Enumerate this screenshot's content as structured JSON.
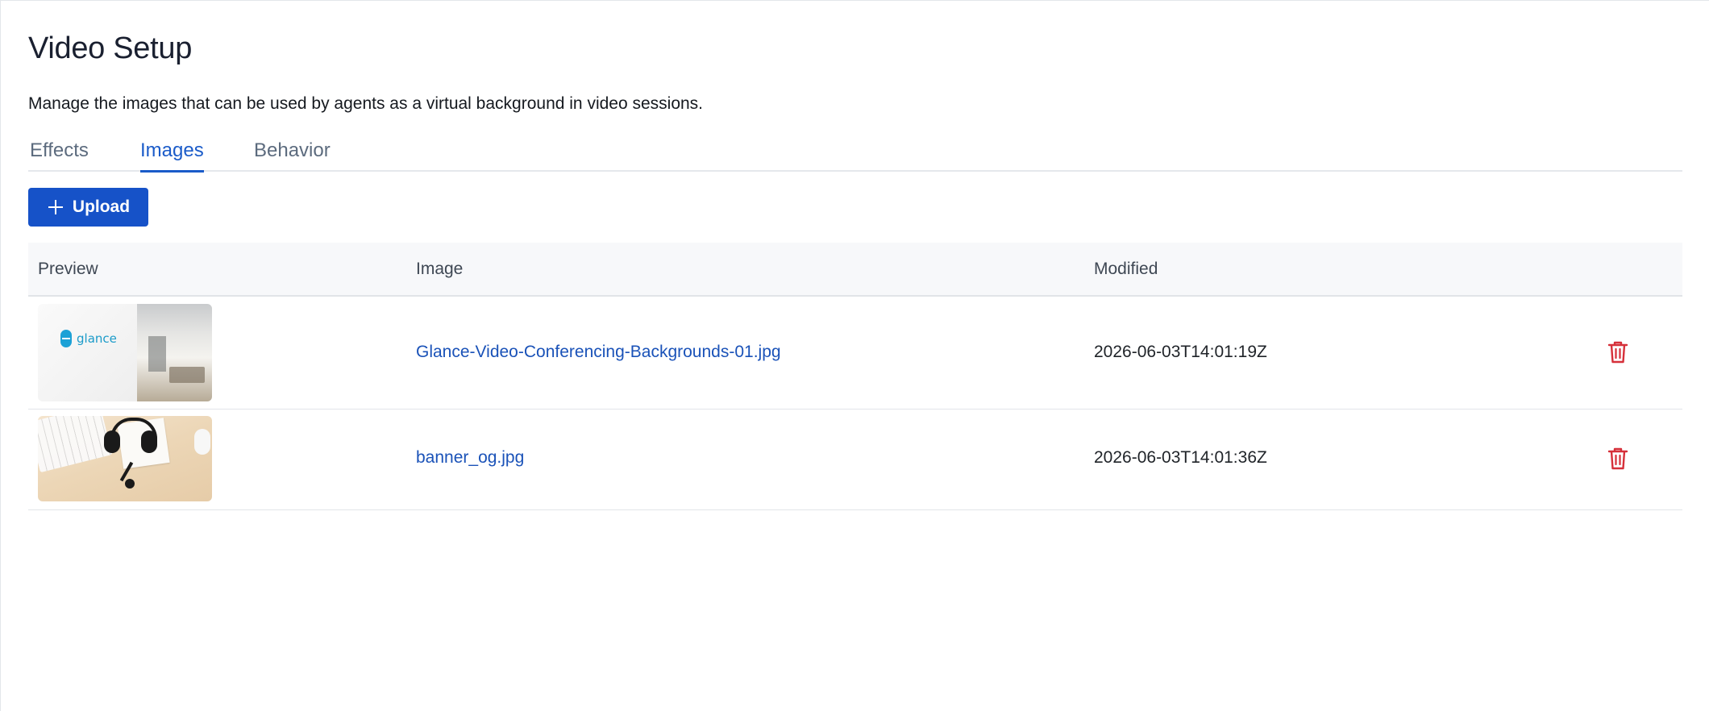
{
  "page": {
    "title": "Video Setup",
    "description": "Manage the images that can be used by agents as a virtual background in video sessions."
  },
  "tabs": [
    {
      "label": "Effects",
      "active": false
    },
    {
      "label": "Images",
      "active": true
    },
    {
      "label": "Behavior",
      "active": false
    }
  ],
  "toolbar": {
    "upload_label": "Upload",
    "upload_icon": "plus-icon"
  },
  "table": {
    "columns": [
      "Preview",
      "Image",
      "Modified"
    ],
    "rows": [
      {
        "preview": "office-background-thumbnail",
        "logo_text": "glance",
        "image": "Glance-Video-Conferencing-Backgrounds-01.jpg",
        "modified": "2026-06-03T14:01:19Z",
        "action_icon": "trash-icon"
      },
      {
        "preview": "desk-headset-thumbnail",
        "image": "banner_og.jpg",
        "modified": "2026-06-03T14:01:36Z",
        "action_icon": "trash-icon"
      }
    ]
  },
  "colors": {
    "accent": "#1652c8",
    "link": "#1a52b8",
    "danger": "#d6303a",
    "tab_inactive": "#5c6b7e"
  }
}
